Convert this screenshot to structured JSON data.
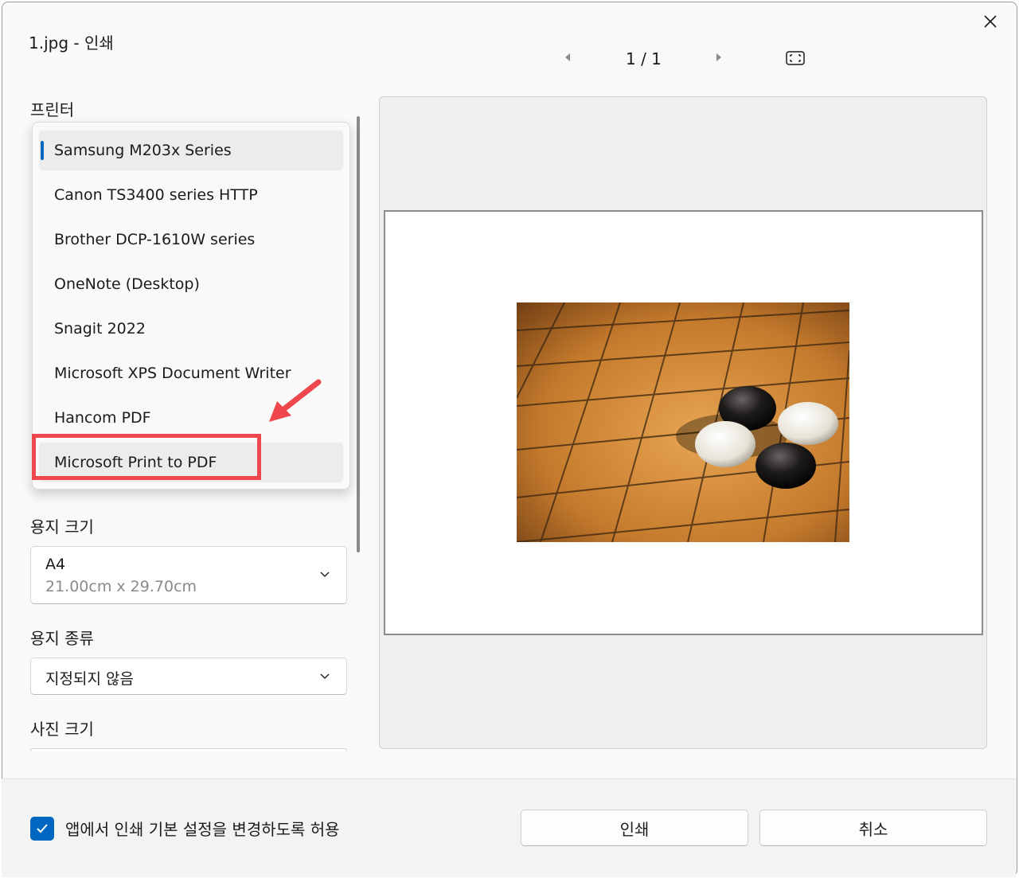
{
  "window": {
    "title": "1.jpg - 인쇄"
  },
  "pager": {
    "count": "1 / 1"
  },
  "printer": {
    "label": "프린터",
    "items": [
      {
        "label": "Samsung M203x Series"
      },
      {
        "label": "Canon TS3400 series HTTP"
      },
      {
        "label": "Brother DCP-1610W series"
      },
      {
        "label": "OneNote (Desktop)"
      },
      {
        "label": "Snagit 2022"
      },
      {
        "label": "Microsoft XPS Document Writer"
      },
      {
        "label": "Hancom PDF"
      },
      {
        "label": "Microsoft Print to PDF"
      }
    ]
  },
  "paper_size": {
    "label": "용지 크기",
    "value": "A4",
    "detail": "21.00cm x 29.70cm"
  },
  "paper_type": {
    "label": "용지 종류",
    "value": "지정되지 않음"
  },
  "photo_size": {
    "label": "사진 크기"
  },
  "footer": {
    "allow_app_settings": "앱에서 인쇄 기본 설정을 변경하도록 허용",
    "print_button": "인쇄",
    "cancel_button": "취소"
  },
  "colors": {
    "accent": "#0067c0",
    "annotation": "#f0474e"
  }
}
